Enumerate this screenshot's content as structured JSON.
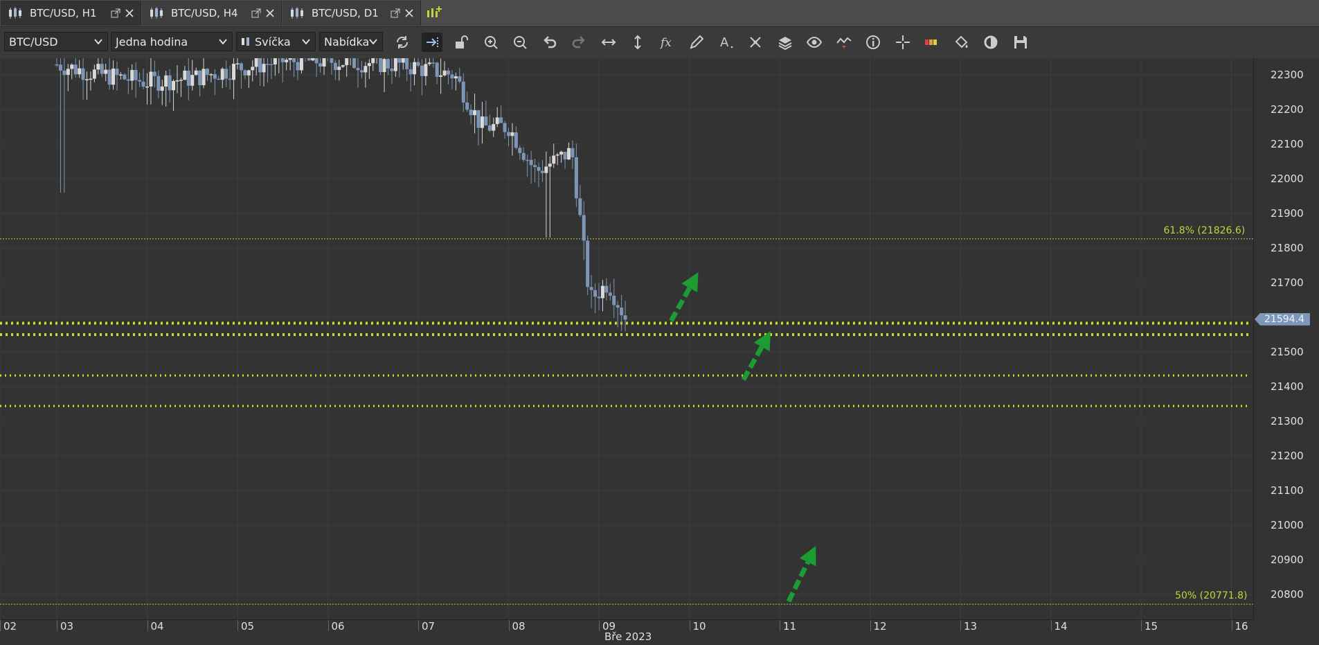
{
  "tabs": [
    {
      "label": "BTC/USD, H1",
      "active": true
    },
    {
      "label": "BTC/USD, H4",
      "active": false
    },
    {
      "label": "BTC/USD, D1",
      "active": false
    }
  ],
  "toolbar": {
    "instrument": "BTC/USD",
    "period": "Jedna hodina",
    "chart_type": "Svíčka",
    "offer_side": "Nabídka",
    "icons": [
      "refresh-icon",
      "shift-chart-icon",
      "lock-icon",
      "zoom-in-icon",
      "zoom-out-icon",
      "undo-icon",
      "redo-icon",
      "horizontal-stretch-icon",
      "vertical-stretch-icon",
      "indicators-fx-icon",
      "drawing-pencil-icon",
      "text-tool-icon",
      "patterns-icon",
      "layers-icon",
      "visibility-eye-icon",
      "signals-icon",
      "info-icon",
      "crosshair-icon",
      "color-bars-icon",
      "paint-bucket-icon",
      "theme-icon",
      "save-icon"
    ]
  },
  "chart_data": {
    "type": "candlestick",
    "instrument": "BTC/USD",
    "timeframe": "H1",
    "x_tick_labels": [
      "02",
      "03",
      "04",
      "05",
      "06",
      "07",
      "08",
      "09",
      "10",
      "11",
      "12",
      "13",
      "14",
      "15",
      "16"
    ],
    "x_axis_month": "Bře 2023",
    "y_tick_labels": [
      "22300",
      "22200",
      "22100",
      "22000",
      "21900",
      "21800",
      "21700",
      "21600",
      "21500",
      "21400",
      "21300",
      "21200",
      "21100",
      "21000",
      "20900",
      "20800"
    ],
    "ylim": [
      20730,
      22380
    ],
    "current_price": "21594.4",
    "fibonacci_levels": [
      {
        "label": "61.8% (21826.6)",
        "price": 21826.6
      },
      {
        "label": "50% (20771.8)",
        "price": 20771.8
      }
    ],
    "horizontal_levels": [
      21583,
      21550,
      21432,
      21344
    ],
    "series_close_hourly_approx": [
      {
        "x": 3.0,
        "y": 22330
      },
      {
        "x": 3.5,
        "y": 22300
      },
      {
        "x": 4.0,
        "y": 22280
      },
      {
        "x": 4.5,
        "y": 22290
      },
      {
        "x": 5.0,
        "y": 22320
      },
      {
        "x": 5.5,
        "y": 22340
      },
      {
        "x": 6.0,
        "y": 22340
      },
      {
        "x": 6.8,
        "y": 22330
      },
      {
        "x": 7.4,
        "y": 22300
      },
      {
        "x": 7.7,
        "y": 22150
      },
      {
        "x": 8.0,
        "y": 22150
      },
      {
        "x": 8.3,
        "y": 22020
      },
      {
        "x": 8.7,
        "y": 22080
      },
      {
        "x": 8.9,
        "y": 21650
      },
      {
        "x": 9.1,
        "y": 21700
      },
      {
        "x": 9.3,
        "y": 21595
      }
    ],
    "annotations": [
      {
        "type": "arrow",
        "color": "#1e9c34",
        "from": [
          9.8,
          21590
        ],
        "to": [
          10.1,
          21730
        ]
      },
      {
        "type": "arrow",
        "color": "#1e9c34",
        "from": [
          10.6,
          21420
        ],
        "to": [
          10.9,
          21560
        ]
      },
      {
        "type": "arrow",
        "color": "#1e9c34",
        "from": [
          11.1,
          20780
        ],
        "to": [
          11.4,
          20940
        ]
      }
    ]
  },
  "colors": {
    "bull": "#7e96b6",
    "bear": "#d9d9d9",
    "fib": "#b8c838",
    "dotted": "#d4e02a",
    "arrow": "#1e9c34"
  }
}
